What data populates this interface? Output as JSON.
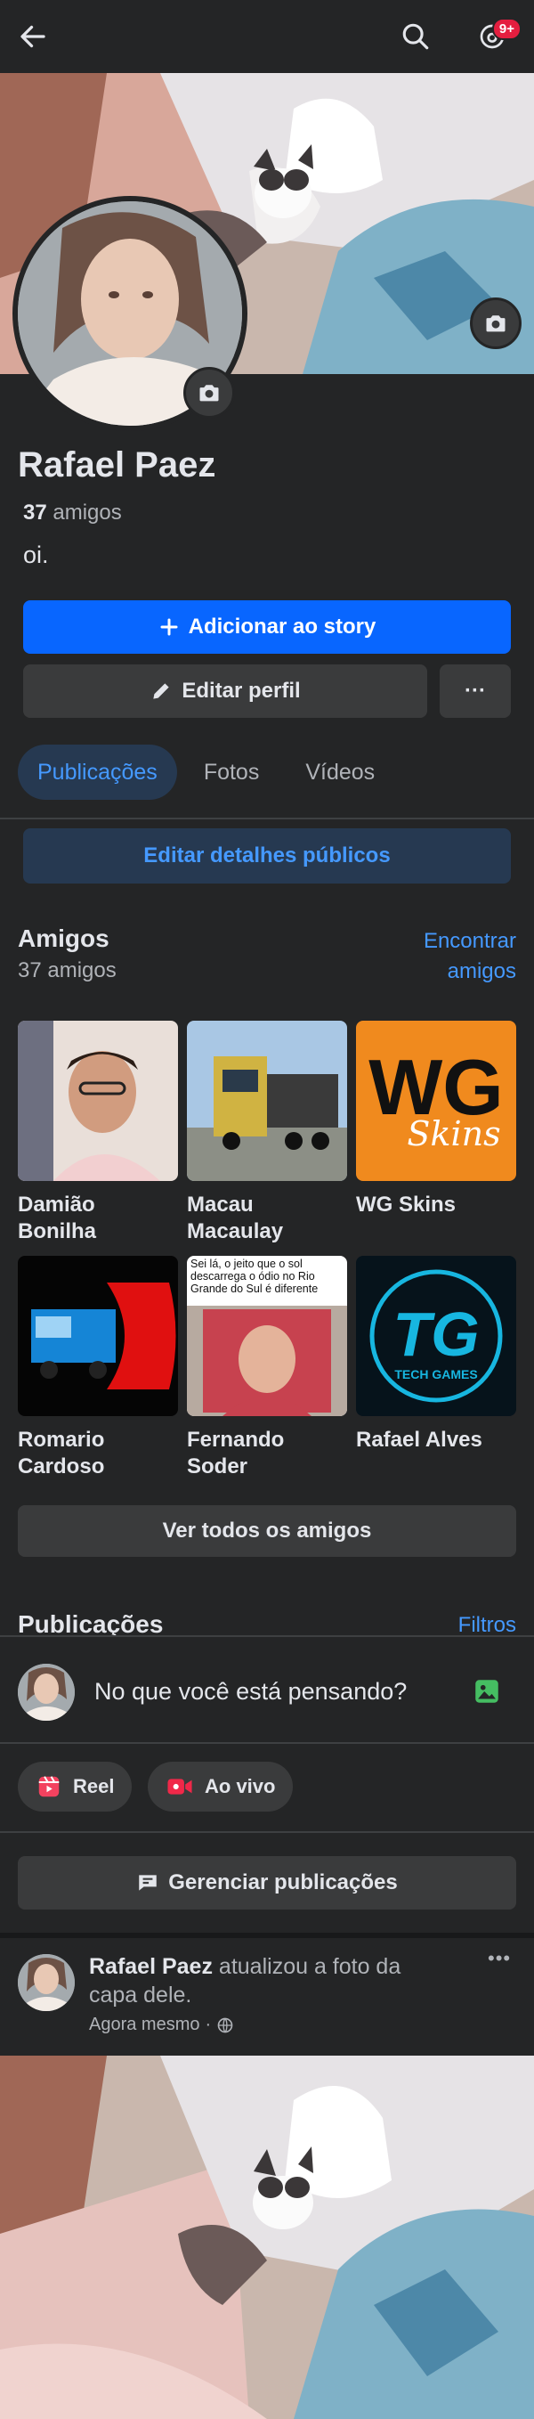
{
  "header": {
    "notification_badge": "9+"
  },
  "profile": {
    "name": "Rafael Paez",
    "friends_number": "37",
    "friends_word": "amigos",
    "bio": "oi."
  },
  "actions": {
    "add_story": "Adicionar ao story",
    "edit_profile": "Editar perfil",
    "more": "···"
  },
  "tabs": [
    "Publicações",
    "Fotos",
    "Vídeos"
  ],
  "edit_public_details": "Editar detalhes públicos",
  "friends_section": {
    "title": "Amigos",
    "count_label": "37 amigos",
    "find_link": "Encontrar amigos",
    "friends": [
      {
        "name": "Damião Bonilha"
      },
      {
        "name": "Macau Macaulay"
      },
      {
        "name": "WG Skins"
      },
      {
        "name": "Romario Cardoso"
      },
      {
        "name": "Fernando Soder"
      },
      {
        "name": "Rafael Alves"
      }
    ],
    "meme_text": "Sei lá, o jeito que o sol descarrega o ódio no Rio Grande do Sul  é diferente",
    "wg_logo_text": "WG",
    "wg_logo_sub": "Skins",
    "tg_logo_text": "TG",
    "tg_logo_sub": "TECH GAMES",
    "see_all": "Ver todos os amigos"
  },
  "posts_section": {
    "title": "Publicações",
    "filters": "Filtros",
    "composer_placeholder": "No que você está pensando?",
    "reel": "Reel",
    "live": "Ao vivo",
    "manage_posts": "Gerenciar publicações"
  },
  "post": {
    "author": "Rafael Paez",
    "action_text": "atualizou a foto da capa dele.",
    "time": "Agora mesmo",
    "more": "•••"
  },
  "colors": {
    "background": "#242526",
    "primary": "#0866ff",
    "link": "#4599ff",
    "badge": "#e41e3f",
    "photo_icon": "#45bd62",
    "reel_icon": "#f3425f",
    "live_icon": "#f02849"
  }
}
